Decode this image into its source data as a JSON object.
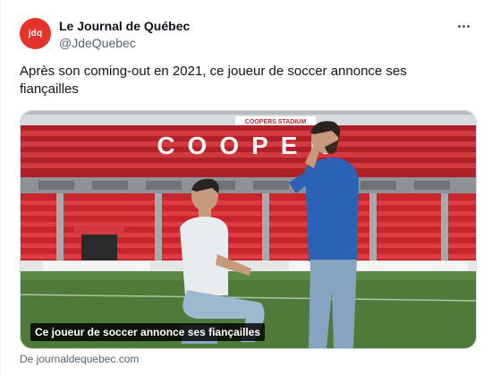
{
  "account": {
    "avatar_text": "jdq",
    "name": "Le Journal de Québec",
    "handle": "@JdeQuebec",
    "brand_color": "#e3332b"
  },
  "tweet": {
    "text": "Après son coming-out en 2021, ce joueur de soccer annonce ses fiançailles"
  },
  "media": {
    "stadium_sign_top": "COOPERS STADIUM",
    "stadium_seat_letters": "COOPER",
    "overlay_caption": "Ce joueur de soccer annonce ses fiançailles",
    "seat_color": "#c9252c",
    "grass_color": "#4f7a3a"
  },
  "link_card": {
    "source_text": "De journaldequebec.com"
  },
  "icons": {
    "more": "more-horizontal-icon"
  }
}
